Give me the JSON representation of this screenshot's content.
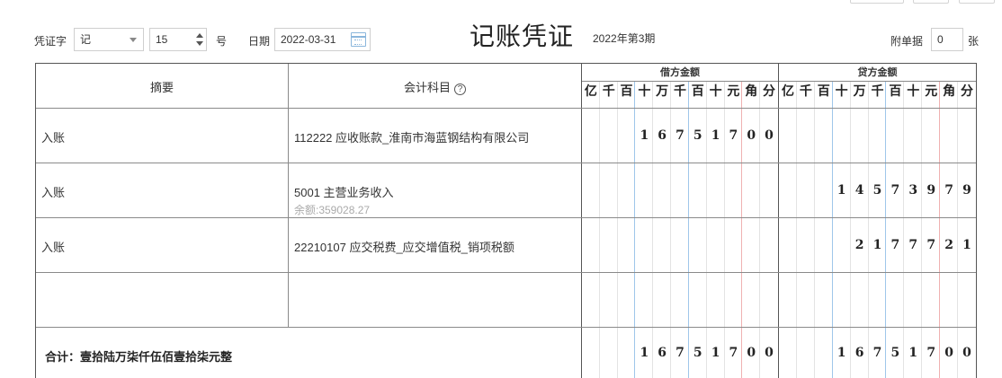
{
  "header": {
    "voucher_word_label": "凭证字",
    "voucher_word_value": "记",
    "voucher_no_value": "15",
    "voucher_no_suffix": "号",
    "date_label": "日期",
    "date_value": "2022-03-31",
    "title": "记账凭证",
    "period": "2022年第3期",
    "attachments_label": "附单据",
    "attachments_value": "0",
    "attachments_suffix": "张"
  },
  "columns": {
    "summary": "摘要",
    "account": "会计科目",
    "help_icon": "?",
    "debit": "借方金额",
    "credit": "贷方金额",
    "digit_units": [
      "亿",
      "千",
      "百",
      "十",
      "万",
      "千",
      "百",
      "十",
      "元",
      "角",
      "分"
    ]
  },
  "entries": [
    {
      "summary": "入账",
      "account": "112222 应收账款_淮南市海蓝钢结构有限公司",
      "balance": "",
      "debit_digits": [
        "",
        "",
        "",
        "1",
        "6",
        "7",
        "5",
        "1",
        "7",
        "0",
        "0"
      ],
      "credit_digits": [
        "",
        "",
        "",
        "",
        "",
        "",
        "",
        "",
        "",
        "",
        ""
      ]
    },
    {
      "summary": "入账",
      "account": "5001 主营业务收入",
      "balance": "余额:359028.27",
      "debit_digits": [
        "",
        "",
        "",
        "",
        "",
        "",
        "",
        "",
        "",
        "",
        ""
      ],
      "credit_digits": [
        "",
        "",
        "",
        "1",
        "4",
        "5",
        "7",
        "3",
        "9",
        "7",
        "9"
      ]
    },
    {
      "summary": "入账",
      "account": "22210107 应交税费_应交增值税_销项税额",
      "balance": "",
      "debit_digits": [
        "",
        "",
        "",
        "",
        "",
        "",
        "",
        "",
        "",
        "",
        ""
      ],
      "credit_digits": [
        "",
        "",
        "",
        "",
        "2",
        "1",
        "7",
        "7",
        "7",
        "2",
        "1"
      ]
    },
    {
      "summary": "",
      "account": "",
      "balance": "",
      "debit_digits": [
        "",
        "",
        "",
        "",
        "",
        "",
        "",
        "",
        "",
        "",
        ""
      ],
      "credit_digits": [
        "",
        "",
        "",
        "",
        "",
        "",
        "",
        "",
        "",
        "",
        ""
      ]
    }
  ],
  "total": {
    "text": "合计：壹拾陆万柒仟伍佰壹拾柒元整",
    "debit_digits": [
      "",
      "",
      "",
      "1",
      "6",
      "7",
      "5",
      "1",
      "7",
      "0",
      "0"
    ],
    "credit_digits": [
      "",
      "",
      "",
      "1",
      "6",
      "7",
      "5",
      "1",
      "7",
      "0",
      "0"
    ]
  },
  "colors": {
    "blue_separator": "#9fc6ea",
    "red_separator": "#efb1b1",
    "calendar_icon": "#8ab6dc"
  }
}
